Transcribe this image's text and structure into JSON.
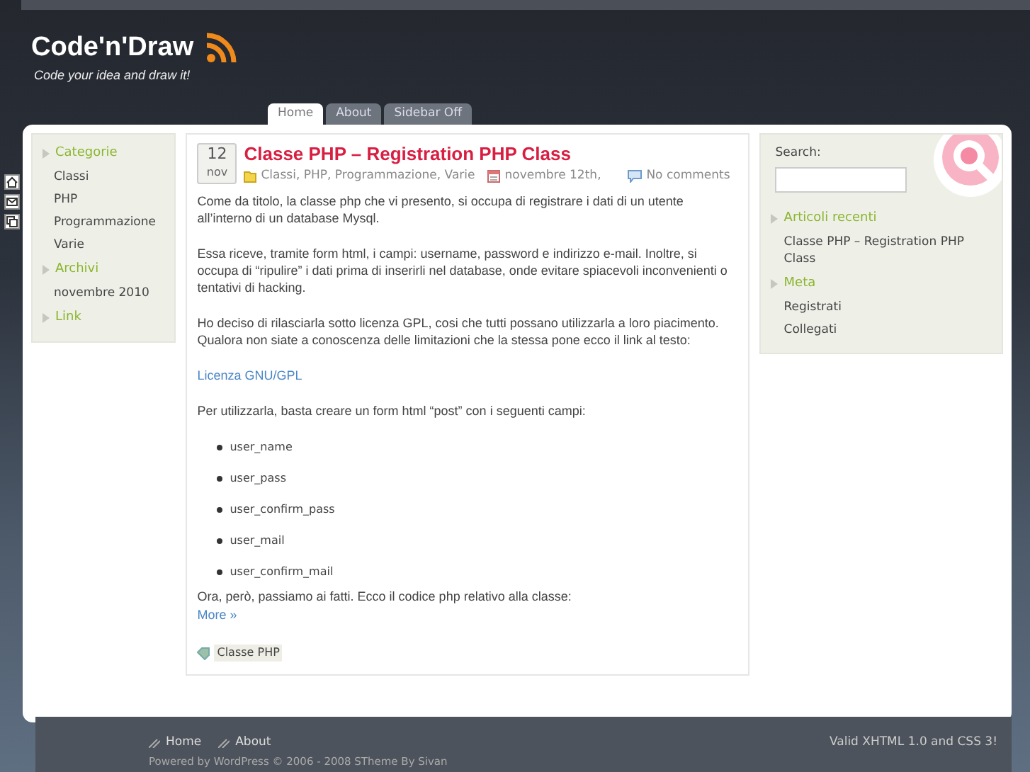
{
  "site": {
    "title": "Code'n'Draw",
    "tagline": "Code your idea and draw it!"
  },
  "tabs": [
    {
      "label": "Home",
      "selected": true
    },
    {
      "label": "About",
      "selected": false
    },
    {
      "label": "Sidebar Off",
      "selected": false
    }
  ],
  "left_sidebar": {
    "sections": [
      {
        "heading": "Categorie",
        "items": [
          "Classi",
          "PHP",
          "Programmazione",
          "Varie"
        ]
      },
      {
        "heading": "Archivi",
        "items": [
          "novembre 2010"
        ]
      },
      {
        "heading": "Link"
      }
    ]
  },
  "post": {
    "day": "12",
    "month": "nov",
    "title": "Classe PHP – Registration PHP Class",
    "categories": "Classi, PHP, Programmazione, Varie",
    "date": "novembre 12th,",
    "comments": "No comments",
    "body": [
      {
        "kind": "paragraph",
        "text": "Come da titolo, la classe php che vi presento, si occupa di registrare i dati di un utente all’interno di un database Mysql."
      },
      {
        "kind": "paragraph",
        "text": "Essa riceve, tramite form html, i campi: username, password e indirizzo e-mail. Inoltre, si occupa di “ripulire” i dati prima di inserirli nel database, onde evitare spiacevoli inconvenienti o tentativi di hacking."
      },
      {
        "kind": "paragraph",
        "text": "Ho deciso di rilasciarla sotto licenza GPL, cosi che tutti possano utilizzarla a loro piacimento. Qualora non siate a conoscenza delle limitazioni che la stessa pone ecco il link al testo:"
      },
      {
        "kind": "link",
        "text": "Licenza GNU/GPL"
      },
      {
        "kind": "paragraph",
        "text": "Per utilizzarla, basta creare un form html “post” con i seguenti campi:"
      },
      {
        "kind": "list",
        "items": [
          "user_name",
          "user_pass",
          "user_confirm_pass",
          "user_mail",
          "user_confirm_mail"
        ]
      },
      {
        "kind": "paragraph",
        "text": "Ora, però, passiamo ai fatti. Ecco il codice php relativo alla classe:"
      }
    ],
    "more": "More »",
    "tag": "Classe PHP"
  },
  "right_sidebar": {
    "search_label": "Search:",
    "sections": [
      {
        "heading": "Articoli recenti",
        "items": [
          "Classe PHP – Registration PHP Class"
        ]
      },
      {
        "heading": "Meta",
        "items": [
          "Registrati",
          "Collegati"
        ]
      }
    ]
  },
  "footer": {
    "links": [
      "Home",
      "About"
    ],
    "validity": "Valid XHTML 1.0 and CSS 3!",
    "credits": "Powered by WordPress © 2006 - 2008 STheme By Sivan"
  }
}
